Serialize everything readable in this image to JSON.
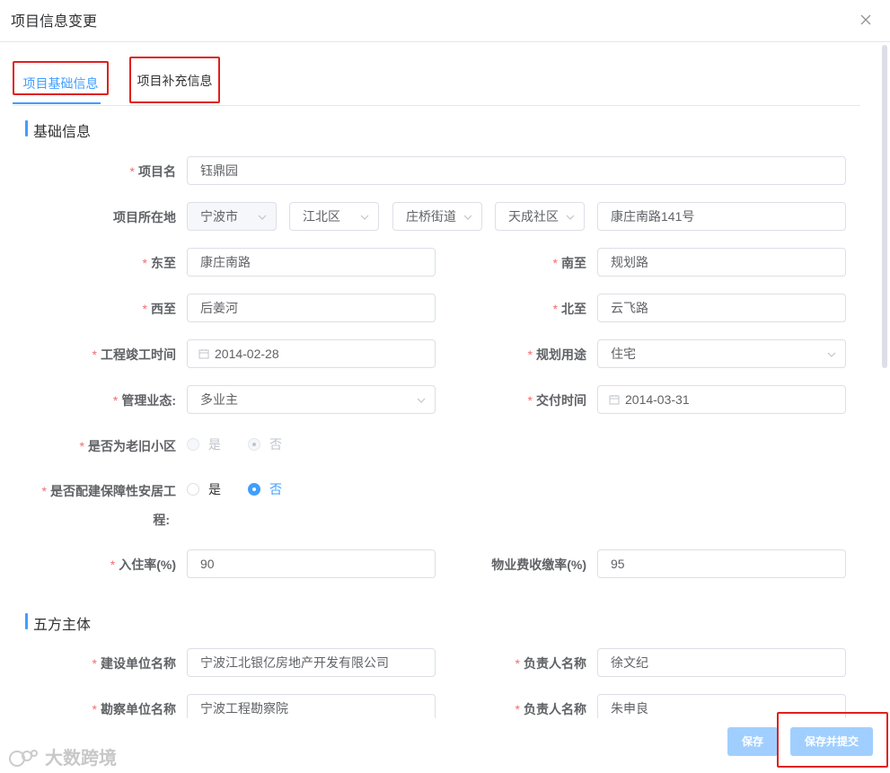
{
  "dialog": {
    "title": "项目信息变更"
  },
  "tabs": [
    {
      "label": "项目基础信息"
    },
    {
      "label": "项目补充信息"
    }
  ],
  "basic": {
    "section_title": "基础信息",
    "project_name": {
      "label": "项目名",
      "value": "钰鼎园"
    },
    "location": {
      "label": "项目所在地",
      "city": "宁波市",
      "district": "江北区",
      "street": "庄桥街道",
      "community": "天成社区",
      "address": "康庄南路141号"
    },
    "east": {
      "label": "东至",
      "value": "康庄南路"
    },
    "south": {
      "label": "南至",
      "value": "规划路"
    },
    "west": {
      "label": "西至",
      "value": "后姜河"
    },
    "north": {
      "label": "北至",
      "value": "云飞路"
    },
    "completion_date": {
      "label": "工程竣工时间",
      "value": "2014-02-28"
    },
    "planning_use": {
      "label": "规划用途",
      "value": "住宅"
    },
    "management": {
      "label": "管理业态:",
      "value": "多业主"
    },
    "delivery_date": {
      "label": "交付时间",
      "value": "2014-03-31"
    },
    "old_community": {
      "label": "是否为老旧小区",
      "yes": "是",
      "no": "否"
    },
    "affordable": {
      "label_line1": "是否配建保障性安居工",
      "label_line2": "程:",
      "yes": "是",
      "no": "否"
    },
    "occupancy": {
      "label": "入住率(%)",
      "value": "90"
    },
    "fee_rate": {
      "label": "物业费收缴率(%)",
      "value": "95"
    }
  },
  "five_parties": {
    "section_title": "五方主体",
    "builder": {
      "label": "建设单位名称",
      "value": "宁波江北银亿房地产开发有限公司"
    },
    "builder_contact": {
      "label": "负责人名称",
      "value": "徐文纪"
    },
    "surveyor": {
      "label": "勘察单位名称",
      "value": "宁波工程勘察院"
    },
    "surveyor_contact": {
      "label": "负责人名称",
      "value": "朱申良"
    }
  },
  "footer": {
    "save": "保存",
    "save_submit": "保存并提交"
  },
  "watermark": {
    "text": "大数跨境"
  }
}
